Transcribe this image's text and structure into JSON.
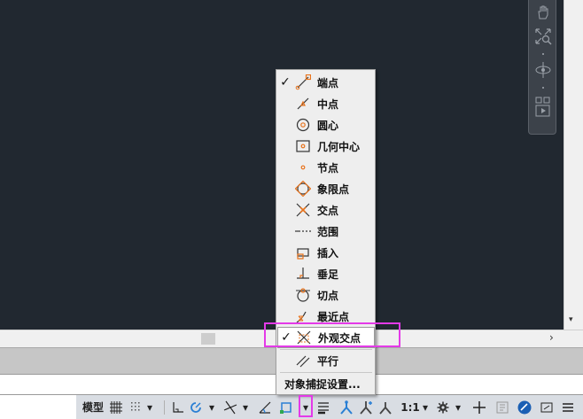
{
  "menu": {
    "items": [
      {
        "label": "端点",
        "checked": true,
        "icon": "endpoint-icon"
      },
      {
        "label": "中点",
        "checked": false,
        "icon": "midpoint-icon"
      },
      {
        "label": "圆心",
        "checked": false,
        "icon": "center-icon"
      },
      {
        "label": "几何中心",
        "checked": false,
        "icon": "geometric-center-icon"
      },
      {
        "label": "节点",
        "checked": false,
        "icon": "node-icon"
      },
      {
        "label": "象限点",
        "checked": false,
        "icon": "quadrant-icon"
      },
      {
        "label": "交点",
        "checked": false,
        "icon": "intersection-icon"
      },
      {
        "label": "范围",
        "checked": false,
        "icon": "extension-icon"
      },
      {
        "label": "插入",
        "checked": false,
        "icon": "insertion-icon"
      },
      {
        "label": "垂足",
        "checked": false,
        "icon": "perpendicular-icon"
      },
      {
        "label": "切点",
        "checked": false,
        "icon": "tangent-icon"
      },
      {
        "label": "最近点",
        "checked": false,
        "icon": "nearest-icon"
      },
      {
        "label": "外观交点",
        "checked": true,
        "icon": "apparent-intersection-icon"
      },
      {
        "label": "平行",
        "checked": false,
        "icon": "parallel-icon"
      }
    ],
    "settings_label": "对象捕捉设置...",
    "check_glyph": "✓"
  },
  "statusbar": {
    "model_label": "模型",
    "scale_label": "1:1",
    "dropdown_glyph": "▾"
  },
  "scroll": {
    "right_arrow": "›",
    "down_arrow": "▾"
  },
  "colors": {
    "canvas": "#212830",
    "highlight": "#e43ae8",
    "osnap_marker": "#e8731c",
    "accent_blue": "#2a7fd4"
  }
}
